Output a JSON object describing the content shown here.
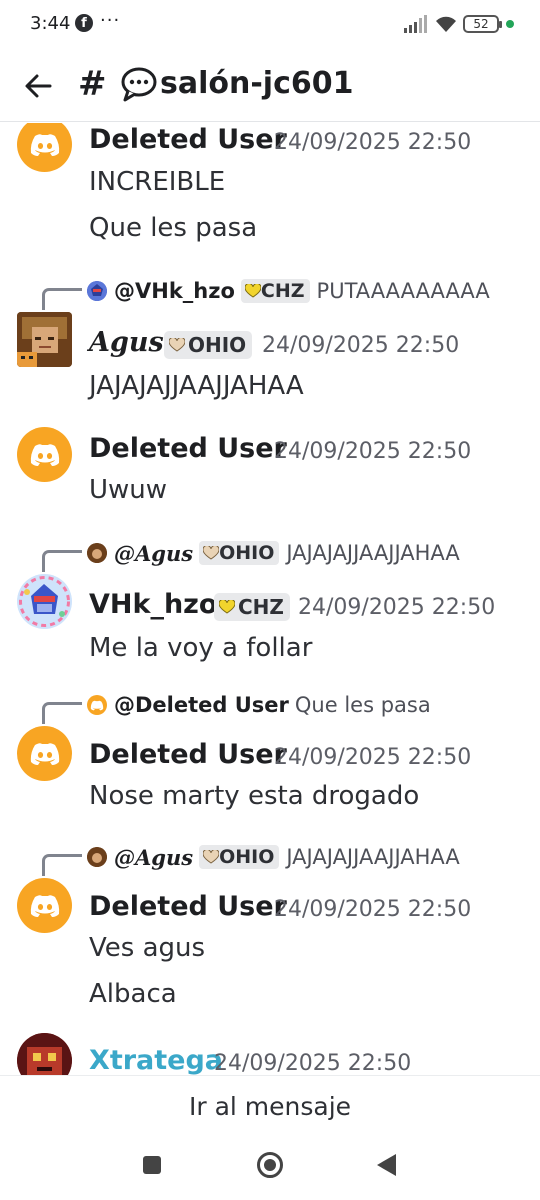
{
  "status_bar": {
    "time": "3:44",
    "battery": "52",
    "more": "···"
  },
  "header": {
    "hash": "#",
    "channel_name": "salón-jc601"
  },
  "messages": [
    {
      "author": "Deleted User",
      "timestamp": "24/09/2025 22:50",
      "lines": [
        "INCREIBLE",
        "Que les pasa"
      ]
    },
    {
      "reply": {
        "name": "@VHk_hzo",
        "tag": "CHZ",
        "text": "PUTAAAAAAAAA"
      },
      "author": "Agus",
      "tag": "OHIO",
      "timestamp": "24/09/2025 22:50",
      "lines": [
        "JAJAJAJJAAJJAHAA"
      ]
    },
    {
      "author": "Deleted User",
      "timestamp": "24/09/2025 22:50",
      "lines": [
        "Uwuw"
      ]
    },
    {
      "reply": {
        "name": "@Agus",
        "tag": "OHIO",
        "text": "JAJAJAJJAAJJAHAA"
      },
      "author": "VHk_hzo",
      "tag": "CHZ",
      "timestamp": "24/09/2025 22:50",
      "lines": [
        "Me la voy a follar"
      ]
    },
    {
      "reply": {
        "name": "@Deleted User",
        "text": "Que les pasa"
      },
      "author": "Deleted User",
      "timestamp": "24/09/2025 22:50",
      "lines": [
        "Nose marty esta drogado"
      ]
    },
    {
      "reply": {
        "name": "@Agus",
        "tag": "OHIO",
        "text": "JAJAJAJJAAJJAHAA"
      },
      "author": "Deleted User",
      "timestamp": "24/09/2025 22:50",
      "lines": [
        "Ves agus",
        "Albaca"
      ]
    },
    {
      "author": "Xtratega",
      "timestamp": "24/09/2025 22:50",
      "lines": []
    }
  ],
  "jump_bar": {
    "label": "Ir al mensaje"
  },
  "colors": {
    "discord_orange": "#f8a523",
    "author_cyan": "#3ba8c9",
    "online_green": "#23a559"
  },
  "icons": {
    "back": "arrow-left-icon",
    "chat": "speech-bubble-icon",
    "discord": "discord-logo-icon"
  }
}
